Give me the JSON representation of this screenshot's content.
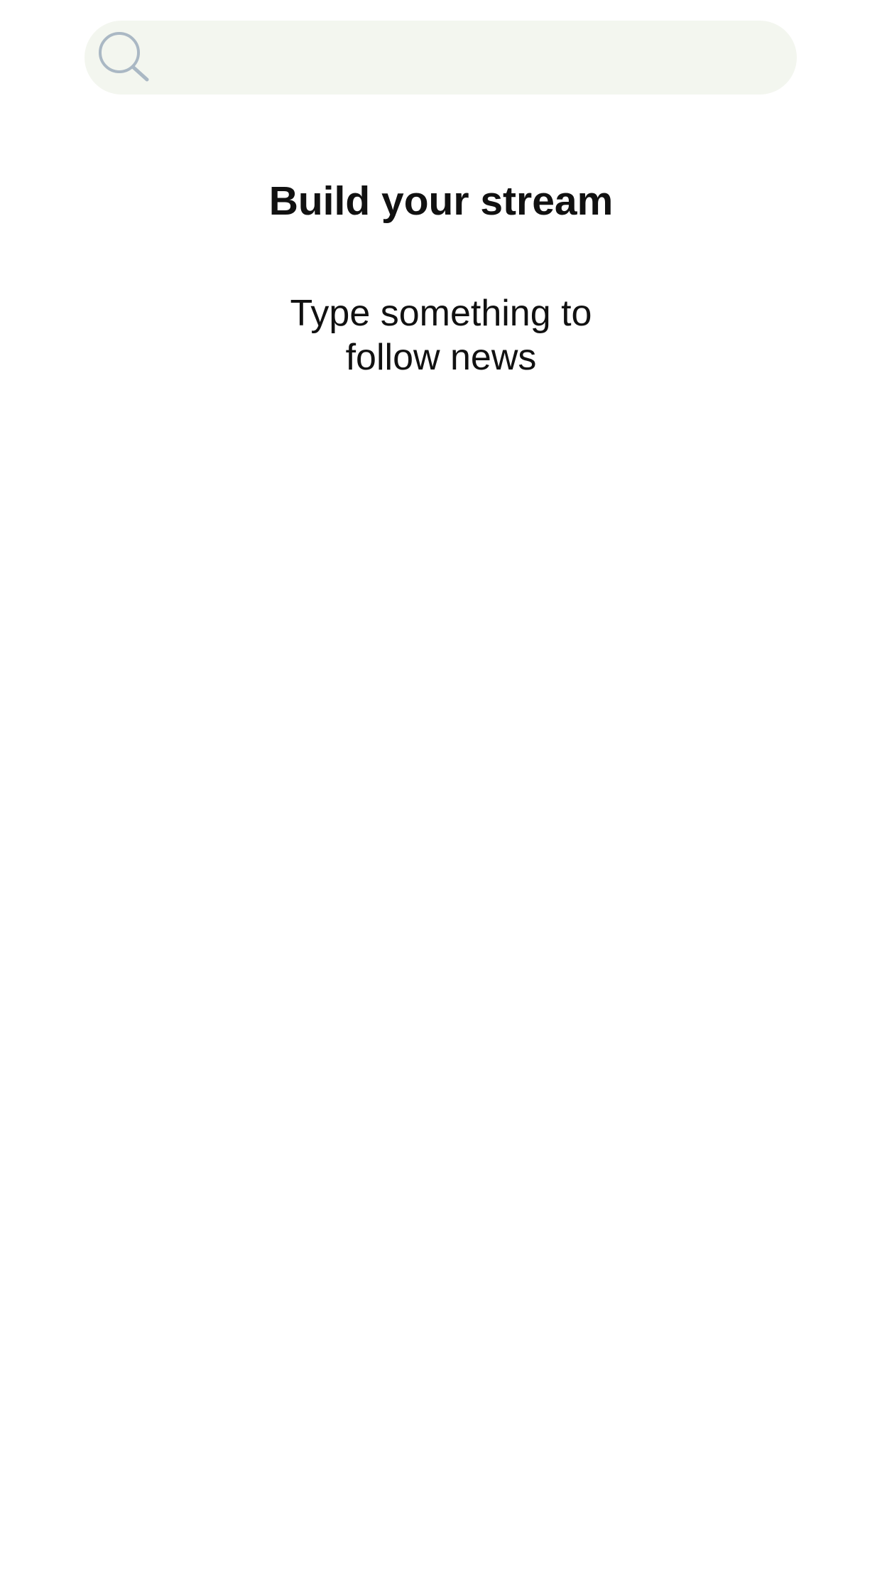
{
  "search": {
    "placeholder": "",
    "value": "",
    "icon": "search-icon",
    "background_color": "#f3f6ef",
    "icon_color": "#aab8c4"
  },
  "main": {
    "title": "Build your stream",
    "message": "Type something to follow news"
  }
}
